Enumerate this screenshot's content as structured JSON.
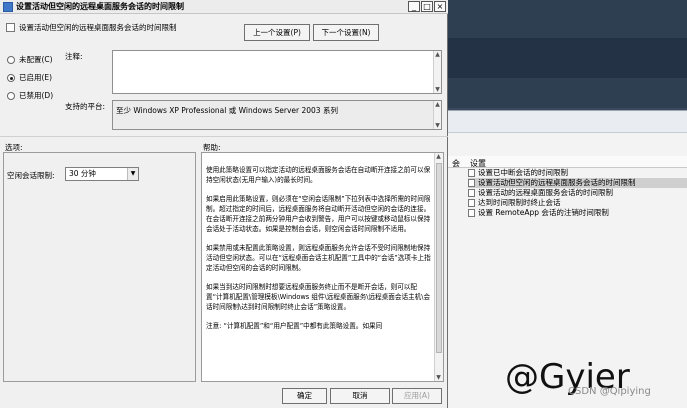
{
  "dialog": {
    "title": "设置活动但空闲的远程桌面服务会话的时间限制",
    "window_controls": [
      "_",
      "□",
      "×"
    ],
    "header_text": "设置活动但空闲的远程桌面服务会话的时间限制",
    "prev_button": "上一个设置(P)",
    "next_button": "下一个设置(N)",
    "radios": [
      {
        "label": "未配置(C)",
        "selected": false
      },
      {
        "label": "已启用(E)",
        "selected": true
      },
      {
        "label": "已禁用(D)",
        "selected": false
      }
    ],
    "comment_label": "注释:",
    "platform_label": "支持的平台:",
    "platform_value": "至少 Windows XP Professional 或 Windows Server 2003 系列",
    "options_label": "选项:",
    "help_label": "帮助:",
    "option_field_label": "空闲会话限制:",
    "option_field_value": "30 分钟",
    "help_paragraphs": [
      "使用此策略设置可以指定活动的远程桌面服务会话在自动断开连接之前可以保持空闲状态(无用户输入)的最长时间。",
      "如果启用此策略设置，则必须在“空闲会话限制”下拉列表中选择所需的时间限制。超过指定的时间后，远程桌面服务将自动断开活动但空闲的会话的连接。在会话断开连接之前两分钟用户会收到警告，用户可以按键或移动鼠标以保持会话处于活动状态。如果是控制台会话，则空闲会话时间限制不适用。",
      "如果禁用或未配置此策略设置，则远程桌面服务允许会话不受时间限制地保持活动但空闲状态。可以在“远程桌面会话主机配置”工具中的“会话”选项卡上指定活动但空闲的会话的时间限制。",
      "如果当到达时间限制时想要远程桌面服务终止而不是断开会话，则可以配置“计算机配置\\管理模板\\Windows 组件\\远程桌面服务\\远程桌面会话主机\\会话时间限制\\达到时间限制时终止会话”策略设置。",
      "注意: “计算机配置”和“用户配置”中都有此策略设置。如果同"
    ],
    "ok_button": "确定",
    "cancel_button": "取消",
    "apply_button": "应用(A)"
  },
  "background": {
    "column_letter": "会",
    "column_header": "设置",
    "items": [
      {
        "label": "设置已中断会话的时间限制",
        "selected": false
      },
      {
        "label": "设置活动但空闲的远程桌面服务会话的时间限制",
        "selected": true
      },
      {
        "label": "设置活动的远程桌面服务会话的时间限制",
        "selected": false
      },
      {
        "label": "达到时间限制时终止会话",
        "selected": false
      },
      {
        "label": "设置 RemoteApp 会话的注销时间限制",
        "selected": false
      }
    ],
    "watermark": "@Gyier",
    "csdn_text": "CSDN @Qipiying"
  }
}
